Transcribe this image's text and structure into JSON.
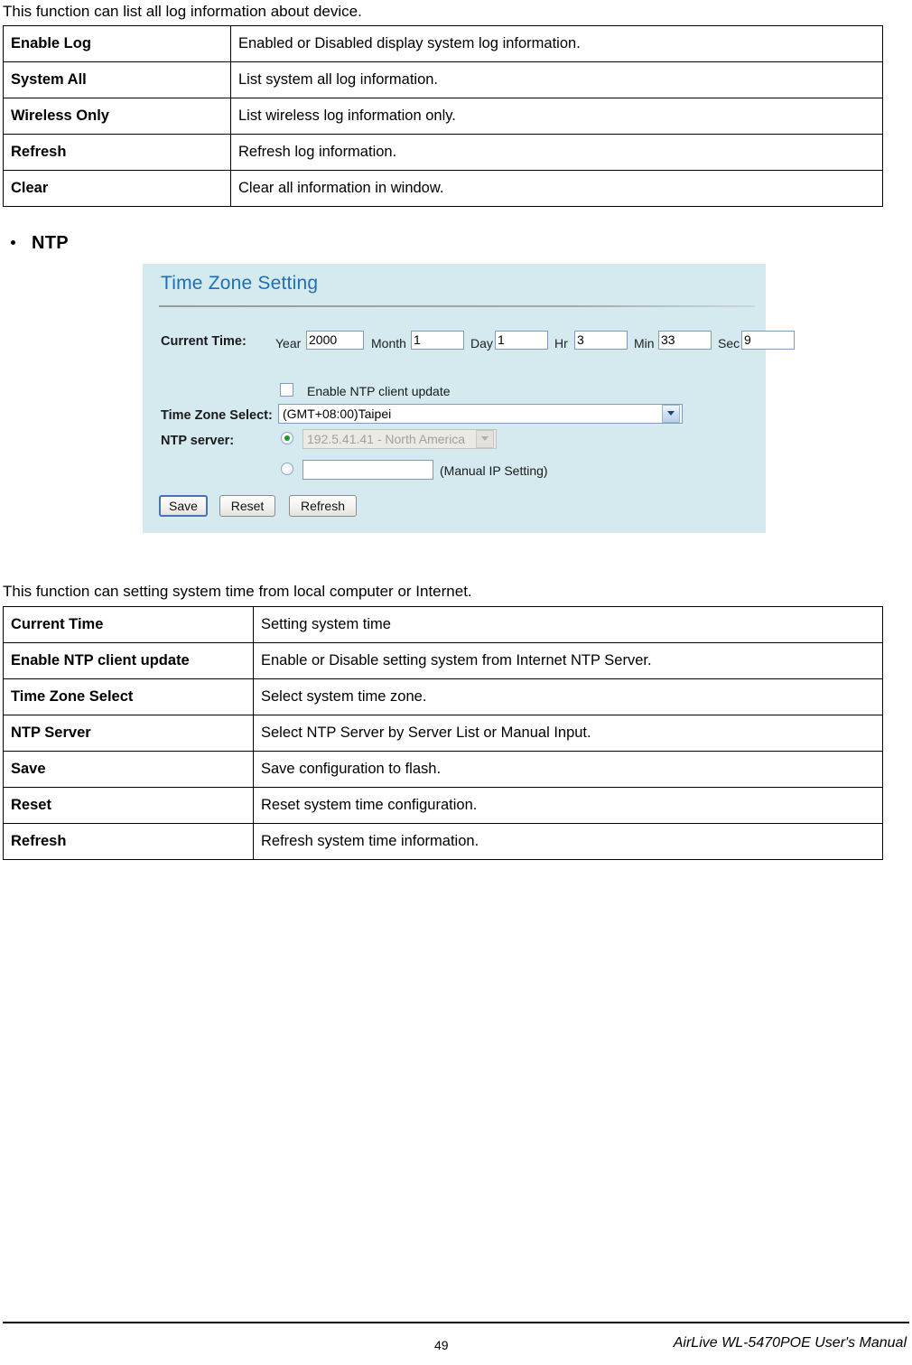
{
  "document": {
    "intro_log": "This function can list all log information about device.",
    "intro_ntp": "This function can setting system time from local computer or Internet.",
    "section_heading": "NTP"
  },
  "log_table": {
    "rows": [
      {
        "term": "Enable Log",
        "definition": "Enabled or Disabled display system log information."
      },
      {
        "term": "System All",
        "definition": "List system all log information."
      },
      {
        "term": "Wireless Only",
        "definition": "List wireless log information only."
      },
      {
        "term": "Refresh",
        "definition": "Refresh log information."
      },
      {
        "term": "Clear",
        "definition": "Clear all information in window."
      }
    ]
  },
  "ntp_table": {
    "rows": [
      {
        "term": "Current Time",
        "definition": "Setting system time"
      },
      {
        "term": "Enable NTP client update",
        "definition": "Enable or Disable setting system from Internet NTP Server."
      },
      {
        "term": "Time Zone Select",
        "definition": "Select system time zone."
      },
      {
        "term": "NTP Server",
        "definition": "Select NTP Server by Server List or Manual Input."
      },
      {
        "term": "Save",
        "definition": "Save configuration to flash."
      },
      {
        "term": "Reset",
        "definition": "Reset system time configuration."
      },
      {
        "term": "Refresh",
        "definition": "Refresh system time information."
      }
    ]
  },
  "ui_panel": {
    "title": "Time Zone Setting",
    "background_color": "#d4eaef",
    "title_color": "#1f6fb4",
    "current_time": {
      "label": "Current Time:",
      "fields": [
        {
          "name": "Year",
          "value": "2000"
        },
        {
          "name": "Month",
          "value": "1"
        },
        {
          "name": "Day",
          "value": "1"
        },
        {
          "name": "Hr",
          "value": "3"
        },
        {
          "name": "Min",
          "value": "33"
        },
        {
          "name": "Sec",
          "value": "9"
        }
      ]
    },
    "enable_ntp": {
      "label": "Enable NTP client update",
      "checked": false
    },
    "time_zone": {
      "label": "Time Zone Select:",
      "selected": "(GMT+08:00)Taipei"
    },
    "ntp_server": {
      "label": "NTP server:",
      "list_option_selected": true,
      "list_value": "192.5.41.41 - North America",
      "manual_option_selected": false,
      "manual_value": "",
      "manual_label": "(Manual IP Setting)"
    },
    "buttons": [
      {
        "label": "Save",
        "focused": true
      },
      {
        "label": "Reset",
        "focused": false
      },
      {
        "label": "Refresh",
        "focused": false
      }
    ]
  },
  "footer": {
    "page_number": "49",
    "manual_title": "AirLive WL-5470POE User's Manual"
  }
}
